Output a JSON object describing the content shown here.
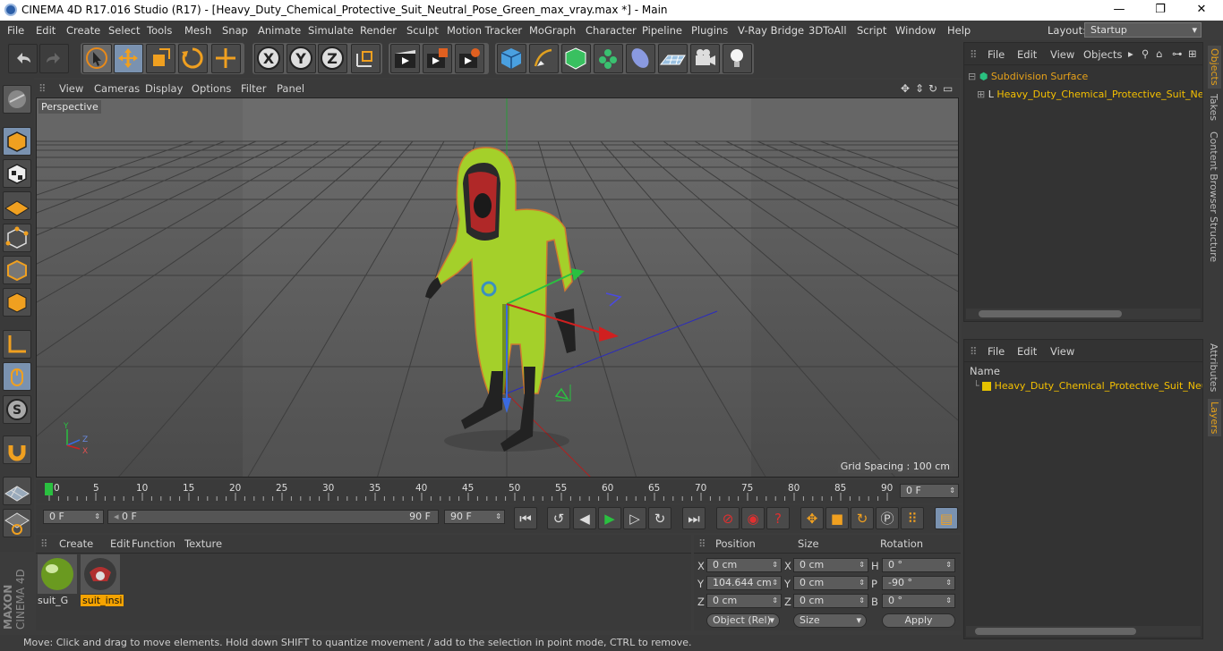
{
  "window": {
    "title": "CINEMA 4D R17.016 Studio (R17) - [Heavy_Duty_Chemical_Protective_Suit_Neutral_Pose_Green_max_vray.max *] - Main",
    "minimize": "—",
    "maximize": "❐",
    "close": "✕"
  },
  "menubar": [
    "File",
    "Edit",
    "Create",
    "Select",
    "Tools",
    "Mesh",
    "Snap",
    "Animate",
    "Simulate",
    "Render",
    "Sculpt",
    "Motion Tracker",
    "MoGraph",
    "Character",
    "Pipeline",
    "Plugins",
    "V-Ray Bridge",
    "3DToAll",
    "Script",
    "Window",
    "Help"
  ],
  "layout": {
    "label": "Layout:",
    "value": "Startup"
  },
  "toolbar_icons": [
    "undo-icon",
    "redo-icon",
    "live-selection-icon",
    "move-icon",
    "scale-icon",
    "rotate-icon",
    "recent-tool-icon",
    "x-axis-icon",
    "y-axis-icon",
    "z-axis-icon",
    "coordinate-system-icon",
    "render-view-icon",
    "render-picture-viewer-icon",
    "edit-render-settings-icon",
    "cube-icon",
    "pen-icon",
    "subdivision-icon",
    "cloner-icon",
    "deformer-icon",
    "floor-icon",
    "camera-icon",
    "light-icon"
  ],
  "axis_labels": {
    "x": "X",
    "y": "Y",
    "z": "Z"
  },
  "viewport": {
    "menu": [
      "View",
      "Cameras",
      "Display",
      "Options",
      "Filter",
      "Panel"
    ],
    "label": "Perspective",
    "grid_spacing": "Grid Spacing : 100 cm",
    "mini_axis": {
      "y": "Y",
      "z": "Z",
      "x": "X"
    }
  },
  "timeline": {
    "ticks": [
      "0",
      "5",
      "10",
      "15",
      "20",
      "25",
      "30",
      "35",
      "40",
      "45",
      "50",
      "55",
      "60",
      "65",
      "70",
      "75",
      "80",
      "85",
      "90"
    ],
    "current_frame": "0 F",
    "start": "0 F",
    "range_start": "0 F",
    "range_end": "90 F",
    "end": "90 F"
  },
  "material_manager": {
    "menu": [
      "Create",
      "Edit",
      "Function",
      "Texture"
    ],
    "materials": [
      {
        "name": "suit_G",
        "selected": false
      },
      {
        "name": "suit_insi",
        "selected": true
      }
    ],
    "brand_maxon": "MAXON",
    "brand_c4d": "CINEMA 4D"
  },
  "coordinates": {
    "headers": {
      "position": "Position",
      "size": "Size",
      "rotation": "Rotation"
    },
    "rows": [
      {
        "axis": "X",
        "pos": "0 cm",
        "size_axis": "X",
        "size": "0 cm",
        "rot_axis": "H",
        "rot": "0 °"
      },
      {
        "axis": "Y",
        "pos": "104.644 cm",
        "size_axis": "Y",
        "size": "0 cm",
        "rot_axis": "P",
        "rot": "-90 °"
      },
      {
        "axis": "Z",
        "pos": "0 cm",
        "size_axis": "Z",
        "size": "0 cm",
        "rot_axis": "B",
        "rot": "0 °"
      }
    ],
    "mode": "Object (Rel)",
    "size_mode": "Size",
    "apply": "Apply"
  },
  "status": "Move: Click and drag to move elements. Hold down SHIFT to quantize movement / add to the selection in point mode, CTRL to remove.",
  "object_manager": {
    "menu": [
      "File",
      "Edit",
      "View",
      "Objects"
    ],
    "items": [
      {
        "name": "Subdivision Surface"
      },
      {
        "name": "Heavy_Duty_Chemical_Protective_Suit_Neut"
      }
    ]
  },
  "layer_manager": {
    "menu": [
      "File",
      "Edit",
      "View"
    ],
    "column": "Name",
    "items": [
      {
        "name": "Heavy_Duty_Chemical_Protective_Suit_Neutr",
        "color": "#e6c200"
      }
    ]
  },
  "side_tabs_top": [
    "Objects",
    "Takes",
    "Content Browser",
    "Structure"
  ],
  "side_tabs_bottom": [
    "Attributes",
    "Layers"
  ],
  "colors": {
    "accent": "#e6a11a",
    "selection": "#f5a300",
    "suit": "#a4d02a"
  }
}
